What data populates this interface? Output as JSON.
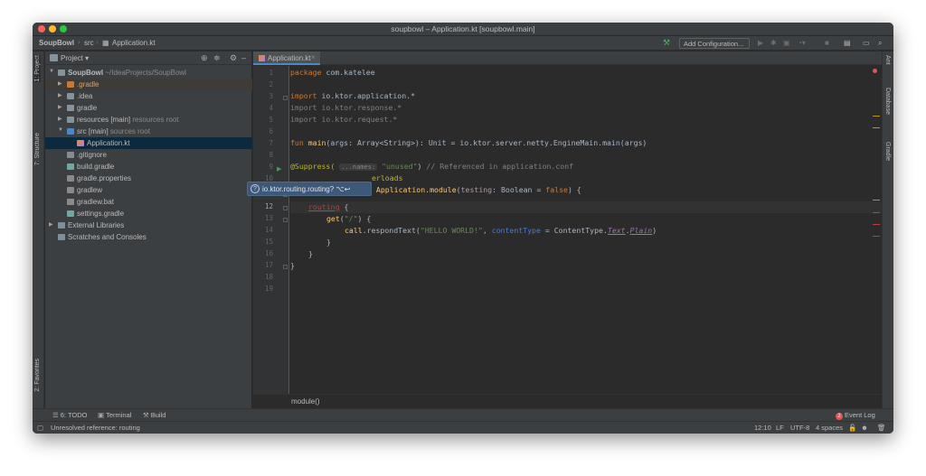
{
  "window": {
    "title": "soupbowl – Application.kt [soupbowl.main]"
  },
  "navbar": {
    "crumbs": [
      "SoupBowl",
      "src",
      "Application.kt"
    ],
    "add_config": "Add Configuration..."
  },
  "left_strip": {
    "project": "1: Project",
    "structure": "7: Structure",
    "favorites": "2: Favorites"
  },
  "right_strip": {
    "ant": "Ant",
    "database": "Database",
    "gradle": "Gradle"
  },
  "project_panel": {
    "title": "Project",
    "tree": [
      {
        "name": "SoupBowl",
        "hint": "~/IdeaProjects/SoupBowl",
        "bold": true
      },
      {
        "name": ".gradle",
        "hint": ""
      },
      {
        "name": ".idea",
        "hint": ""
      },
      {
        "name": "gradle",
        "hint": ""
      },
      {
        "name": "resources [main]",
        "hint": "resources root"
      },
      {
        "name": "src [main]",
        "hint": "sources root"
      },
      {
        "name": "Application.kt",
        "hint": ""
      },
      {
        "name": ".gitignore",
        "hint": ""
      },
      {
        "name": "build.gradle",
        "hint": ""
      },
      {
        "name": "gradle.properties",
        "hint": ""
      },
      {
        "name": "gradlew",
        "hint": ""
      },
      {
        "name": "gradlew.bat",
        "hint": ""
      },
      {
        "name": "settings.gradle",
        "hint": ""
      },
      {
        "name": "External Libraries",
        "hint": ""
      },
      {
        "name": "Scratches and Consoles",
        "hint": ""
      }
    ]
  },
  "editor": {
    "tab": "Application.kt",
    "line_numbers": [
      "1",
      "2",
      "3",
      "4",
      "5",
      "6",
      "7",
      "8",
      "9",
      "10",
      "11",
      "12",
      "13",
      "14",
      "15",
      "16",
      "17",
      "18",
      "19"
    ],
    "current_line": "12",
    "code": {
      "l1_kw": "package",
      "l1_rest": " com.katelee",
      "l3_kw": "import",
      "l3_rest": " io.ktor.application.*",
      "l4": "import io.ktor.response.*",
      "l5": "import io.ktor.request.*",
      "l7_kw": "fun",
      "l7_fn": " main",
      "l7_rest": "(args: Array<String>): Unit = io.ktor.server.netty.EngineMain.main(args)",
      "l9_ann": "@Suppress(",
      "l9_hint": "...names:",
      "l9_str": " \"unused\"",
      "l9_paren": ")",
      "l9_com": " // Referenced in application.conf",
      "l10_ann": "erloads",
      "l11_kw": "fun",
      "l11_fn": " Application.module",
      "l11_open": "(",
      "l11_param": "testing",
      "l11_type": ": Boolean = ",
      "l11_false": "false",
      "l11_rest": ") {",
      "l12_err": "routing",
      "l12_rest": " {",
      "l13_call": "get",
      "l13_open": "(",
      "l13_str": "\"/\"",
      "l13_rest": ") {",
      "l14_call": "call",
      "l14_mid": ".respondText(",
      "l14_str": "\"HELLO WORLD!\"",
      "l14_comma": ", ",
      "l14_named": "contentType",
      "l14_eq": " = ",
      "l14_ct": "ContentType",
      "l14_dot": ".",
      "l14_text": "Text",
      "l14_dot2": ".",
      "l14_plain": "Plain",
      "l14_close": ")",
      "l15": "}",
      "l16": "}",
      "l17": "}"
    },
    "breadcrumb": "module()"
  },
  "popup": {
    "text": "io.ktor.routing.routing? ⌥↩"
  },
  "bottom_tools": {
    "todo": "6: TODO",
    "terminal": "Terminal",
    "build": "Build",
    "event_count": "2",
    "event_log": "Event Log"
  },
  "status": {
    "message": "Unresolved reference: routing",
    "position": "12:10",
    "line_sep": "LF",
    "encoding": "UTF-8",
    "indent": "4 spaces"
  },
  "icons": {
    "close": "×",
    "hammer": "🔨",
    "gear": "⚙",
    "target": "⊕",
    "collapse": "≑",
    "minimize": "–",
    "run": "▶",
    "arrow_right": "▶",
    "arrow_down": "▼"
  },
  "colors": {
    "accent": "#4a88c7",
    "error": "#bc3f3c",
    "keyword": "#cc7832",
    "string": "#6a8759",
    "function": "#ffc66d"
  }
}
